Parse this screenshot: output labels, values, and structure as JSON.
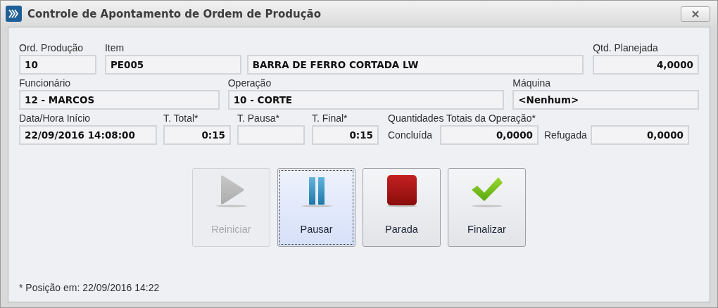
{
  "window": {
    "title": "Controle de Apontamento de Ordem de Produção"
  },
  "rows": [
    {
      "fields": [
        {
          "label": "Ord. Produção",
          "value": "10",
          "kind": "text"
        },
        {
          "label": "Item",
          "value": "PE005",
          "kind": "text"
        },
        {
          "value": "BARRA DE FERRO CORTADA LW",
          "kind": "text"
        },
        {
          "label": "Qtd. Planejada",
          "value": "4,0000",
          "kind": "number"
        }
      ]
    },
    {
      "fields": [
        {
          "label": "Funcionário",
          "value": "12 - MARCOS",
          "kind": "text"
        },
        {
          "label": "Operação",
          "value": "10 - CORTE",
          "kind": "text"
        },
        {
          "label": "Máquina",
          "value": "<Nenhum>",
          "kind": "text"
        }
      ]
    },
    {
      "fields": [
        {
          "label": "Data/Hora Início",
          "value": "22/09/2016 14:08:00",
          "kind": "text"
        },
        {
          "label": "T. Total*",
          "value": "0:15",
          "kind": "number"
        },
        {
          "label": "T. Pausa*",
          "kind": "number"
        },
        {
          "label": "T. Final*",
          "value": "0:15",
          "kind": "number"
        }
      ],
      "quantities": {
        "title": "Quantidades Totais da Operação*",
        "items": [
          {
            "label": "Concluída",
            "value": "0,0000"
          },
          {
            "label": "Refugada",
            "value": "0,0000"
          }
        ]
      }
    }
  ],
  "buttons": [
    {
      "label": "Reiniciar",
      "kind": "play",
      "disabled": true,
      "focused": false
    },
    {
      "label": "Pausar",
      "kind": "pause",
      "disabled": false,
      "focused": true
    },
    {
      "label": "Parada",
      "kind": "stop",
      "disabled": false,
      "focused": false
    },
    {
      "label": "Finalizar",
      "kind": "check",
      "disabled": false,
      "focused": false
    }
  ],
  "footer": "* Posição em: 22/09/2016 14:22"
}
